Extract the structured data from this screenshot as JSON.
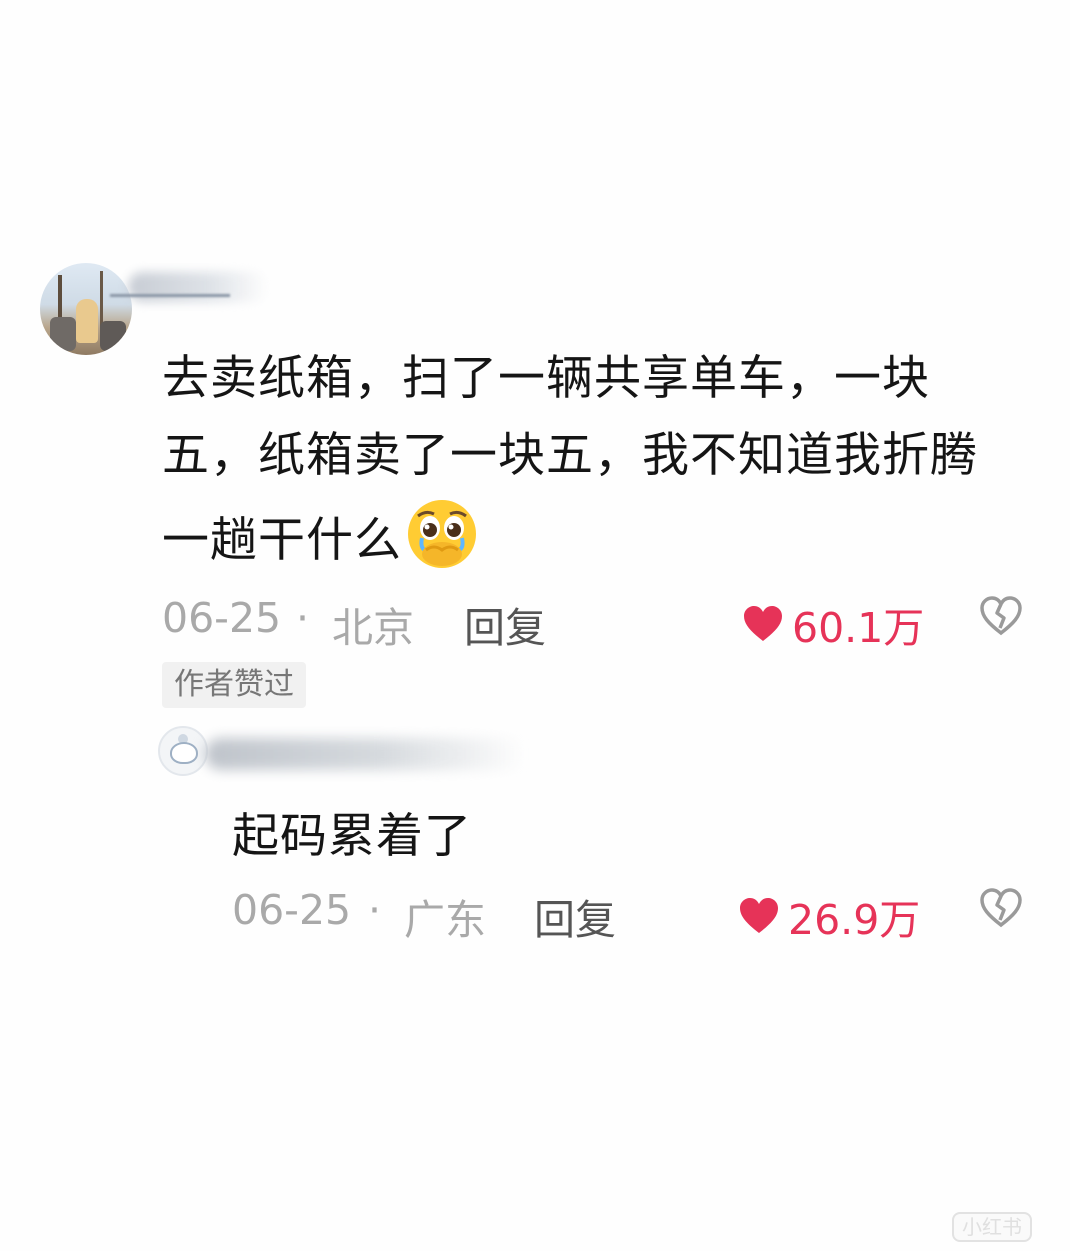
{
  "comment": {
    "text_line1": "去卖纸箱，扫了一辆共享单车，一块",
    "text_line2": "五，纸箱卖了一块五，我不知道我折腾",
    "text_line3": "一趟干什么",
    "emoji_icon": "pleading-face-icon",
    "date": "06-25",
    "dot": "·",
    "location": "北京",
    "reply_label": "回复",
    "likes": "60.1万",
    "author_liked_badge": "作者赞过"
  },
  "reply": {
    "text": "起码累着了",
    "date": "06-25",
    "dot": "·",
    "location": "广东",
    "reply_label": "回复",
    "likes": "26.9万"
  },
  "watermark": "小红书",
  "colors": {
    "like": "#e63358",
    "meta": "#a9a9a9",
    "reply_label": "#555555"
  }
}
